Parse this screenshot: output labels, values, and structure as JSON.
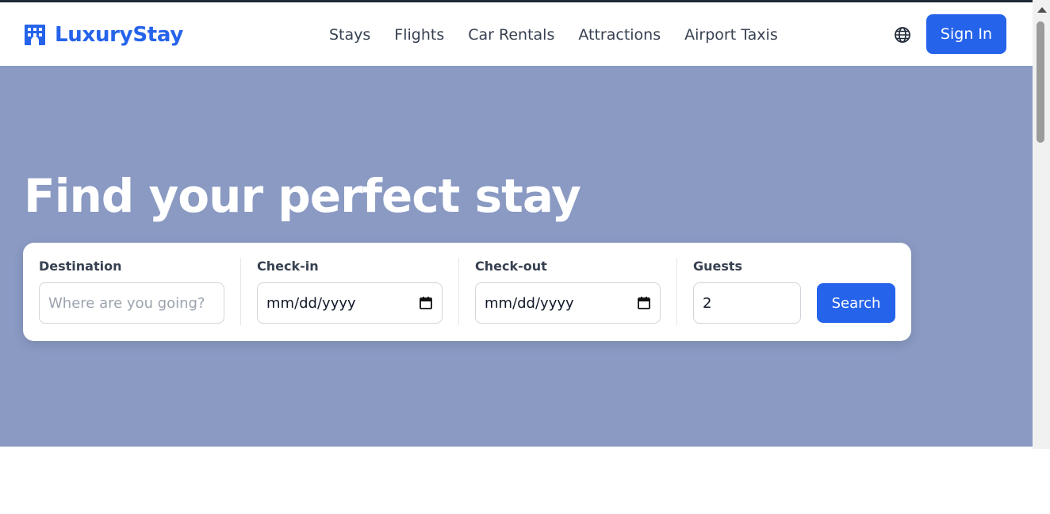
{
  "brand": {
    "name": "LuxuryStay",
    "icon": "hotel-building-icon",
    "color": "#2563eb"
  },
  "nav": {
    "links": [
      "Stays",
      "Flights",
      "Car Rentals",
      "Attractions",
      "Airport Taxis"
    ],
    "language_icon": "globe-icon",
    "sign_in_label": "Sign In"
  },
  "hero": {
    "title": "Find your perfect stay",
    "background": "#8a9ac3"
  },
  "search": {
    "destination": {
      "label": "Destination",
      "placeholder": "Where are you going?",
      "value": ""
    },
    "check_in": {
      "label": "Check-in",
      "value": "mm/dd/yyyy",
      "icon": "calendar-icon"
    },
    "check_out": {
      "label": "Check-out",
      "value": "mm/dd/yyyy",
      "icon": "calendar-icon"
    },
    "guests": {
      "label": "Guests",
      "value": "2"
    },
    "submit_label": "Search"
  },
  "colors": {
    "primary": "#2563eb",
    "text": "#374151"
  }
}
